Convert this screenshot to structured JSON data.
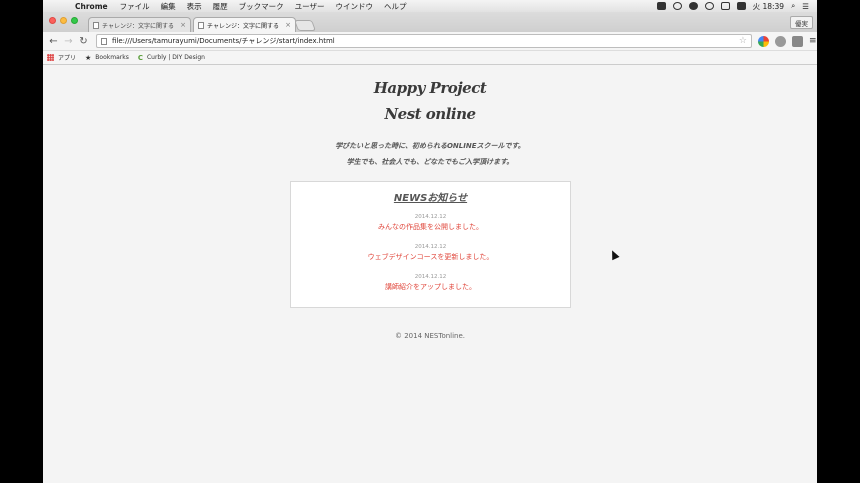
{
  "menubar": {
    "app_name": "Chrome",
    "items": [
      "ファイル",
      "編集",
      "表示",
      "履歴",
      "ブックマーク",
      "ユーザー",
      "ウインドウ",
      "ヘルプ"
    ],
    "clock": "火 18:39"
  },
  "browser": {
    "tabs": [
      {
        "label": "チャレンジ：文字に関する"
      },
      {
        "label": "チャレンジ：文字に関する"
      }
    ],
    "profile_button": "優実",
    "url": "file:///Users/tamurayumi/Documents/チャレンジ/start/index.html",
    "bookmarks": [
      {
        "label": "アプリ",
        "icon": "apps-grid-icon"
      },
      {
        "label": "Bookmarks",
        "icon": "star-icon"
      },
      {
        "label": "Curbly | DIY Design",
        "icon": "curbly-icon"
      }
    ]
  },
  "site": {
    "title_line1": "Happy Project",
    "title_line2": "Nest online",
    "lead1": "学びたいと思った時に、初められるONLINEスクールです。",
    "lead2": "学生でも、社会人でも、どなたでもご入学頂けます。",
    "news": {
      "heading": "NEWSお知らせ",
      "items": [
        {
          "date": "2014.12.12",
          "text": "みんなの作品集を公開しました。"
        },
        {
          "date": "2014.12.12",
          "text": "ウェブデザインコースを更新しました。"
        },
        {
          "date": "2014.12.12",
          "text": "講師紹介をアップしました。"
        }
      ]
    },
    "footer": "© 2014 NESTonline."
  },
  "colors": {
    "news_link": "#e0453a",
    "page_background": "#f4f4f4"
  }
}
